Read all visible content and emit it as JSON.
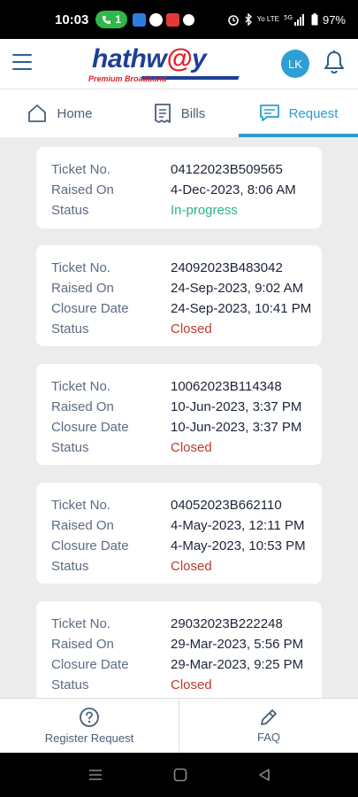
{
  "status_bar": {
    "time": "10:03",
    "call_count": "1",
    "network": "Yo LTE",
    "signal": "5G",
    "battery": "97%"
  },
  "header": {
    "logo_text_a": "hathw",
    "logo_text_at": "@",
    "logo_text_b": "y",
    "logo_tagline": "Premium Broadband",
    "avatar_initials": "LK"
  },
  "tabs": [
    {
      "label": "Home",
      "icon": "home-icon"
    },
    {
      "label": "Bills",
      "icon": "receipt-icon"
    },
    {
      "label": "Request",
      "icon": "chat-icon",
      "active": true
    }
  ],
  "labels": {
    "ticket_no": "Ticket No.",
    "raised_on": "Raised On",
    "closure_date": "Closure Date",
    "status": "Status"
  },
  "tickets": [
    {
      "ticket_no": "04122023B509565",
      "raised_on": "4-Dec-2023, 8:06 AM",
      "closure_date": "",
      "status": "In-progress"
    },
    {
      "ticket_no": "24092023B483042",
      "raised_on": "24-Sep-2023, 9:02 AM",
      "closure_date": "24-Sep-2023, 10:41 PM",
      "status": "Closed"
    },
    {
      "ticket_no": "10062023B114348",
      "raised_on": "10-Jun-2023, 3:37 PM",
      "closure_date": "10-Jun-2023, 3:37 PM",
      "status": "Closed"
    },
    {
      "ticket_no": "04052023B662110",
      "raised_on": "4-May-2023, 12:11 PM",
      "closure_date": "4-May-2023, 10:53 PM",
      "status": "Closed"
    },
    {
      "ticket_no": "29032023B222248",
      "raised_on": "29-Mar-2023, 5:56 PM",
      "closure_date": "29-Mar-2023, 9:25 PM",
      "status": "Closed"
    }
  ],
  "bottom_bar": {
    "register_label": "Register Request",
    "faq_label": "FAQ"
  },
  "colors": {
    "accent": "#2a9fce",
    "in_progress": "#2ab38c",
    "closed": "#c0392b",
    "brand_blue": "#1f3f94",
    "brand_red": "#e0222e"
  }
}
